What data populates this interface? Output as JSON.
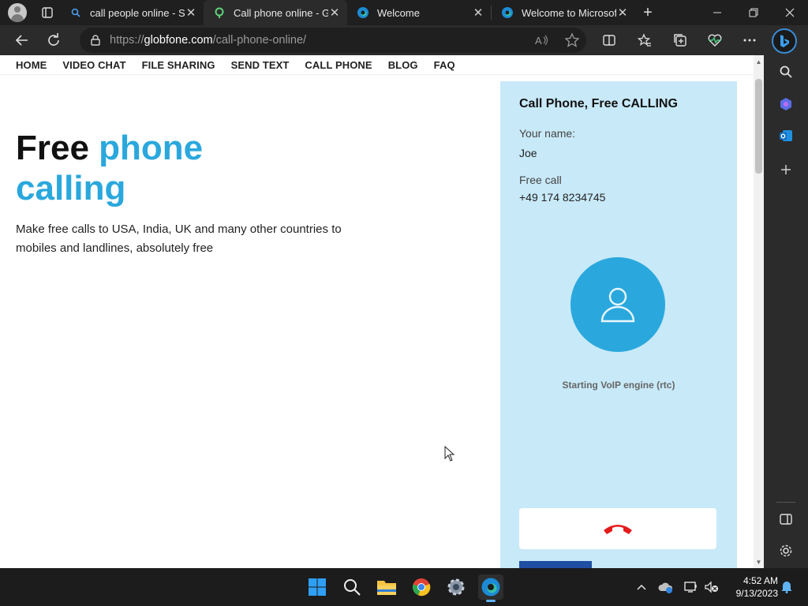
{
  "tabs": [
    {
      "title": "call people online - Se",
      "icon": "search-icon"
    },
    {
      "title": "Call phone online - Gl",
      "icon": "globfone-icon"
    },
    {
      "title": "Welcome",
      "icon": "edge-icon"
    },
    {
      "title": "Welcome to Microsoft",
      "icon": "edge-icon"
    }
  ],
  "address": {
    "prefix": "https://",
    "domain": "globfone.com",
    "path": "/call-phone-online/"
  },
  "site": {
    "nav": [
      "HOME",
      "VIDEO CHAT",
      "FILE SHARING",
      "SEND TEXT",
      "CALL PHONE",
      "BLOG",
      "FAQ"
    ],
    "hero_word1": "Free ",
    "hero_word2": "phone",
    "hero_word3": "calling",
    "description": "Make free calls to USA, India, UK and many other countries to mobiles and landlines, absolutely free"
  },
  "panel": {
    "title": "Call Phone, Free CALLING",
    "name_label": "Your name:",
    "name_value": "Joe",
    "call_label": "Free call",
    "call_number": "+49 174 8234745",
    "status": "Starting VoIP engine (rtc)"
  },
  "taskbar": {
    "time": "4:52 AM",
    "date": "9/13/2023"
  },
  "colors": {
    "accent_blue": "#2aa8dd",
    "panel_bg": "#c8e9f8",
    "hangup_red": "#e41b1b"
  }
}
